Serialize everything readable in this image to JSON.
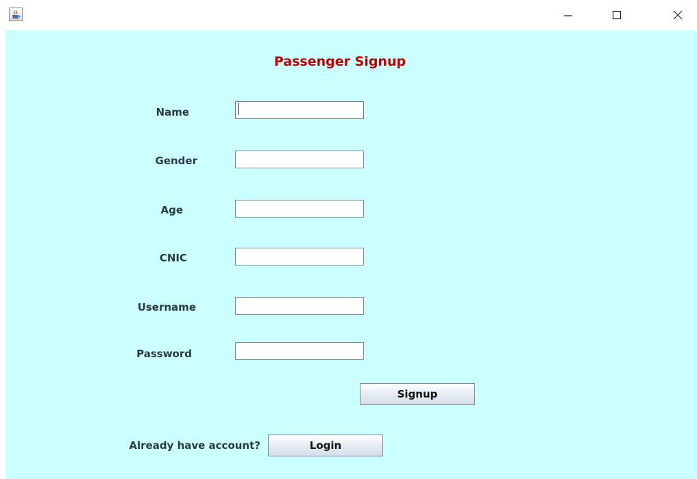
{
  "window": {
    "app_icon": "java-cup-icon",
    "controls": {
      "minimize": "minimize-icon",
      "maximize": "maximize-icon",
      "close": "close-icon"
    }
  },
  "form": {
    "title": "Passenger Signup",
    "fields": {
      "name": {
        "label": "Name",
        "value": ""
      },
      "gender": {
        "label": "Gender",
        "value": ""
      },
      "age": {
        "label": "Age",
        "value": ""
      },
      "cnic": {
        "label": "CNIC",
        "value": ""
      },
      "username": {
        "label": "Username",
        "value": ""
      },
      "password": {
        "label": "Password",
        "value": ""
      }
    },
    "signup_button": "Signup",
    "login_prompt": "Already have account?",
    "login_button": "Login"
  },
  "colors": {
    "background": "#ccffff",
    "title": "#c00000",
    "label": "#2a3a44"
  }
}
